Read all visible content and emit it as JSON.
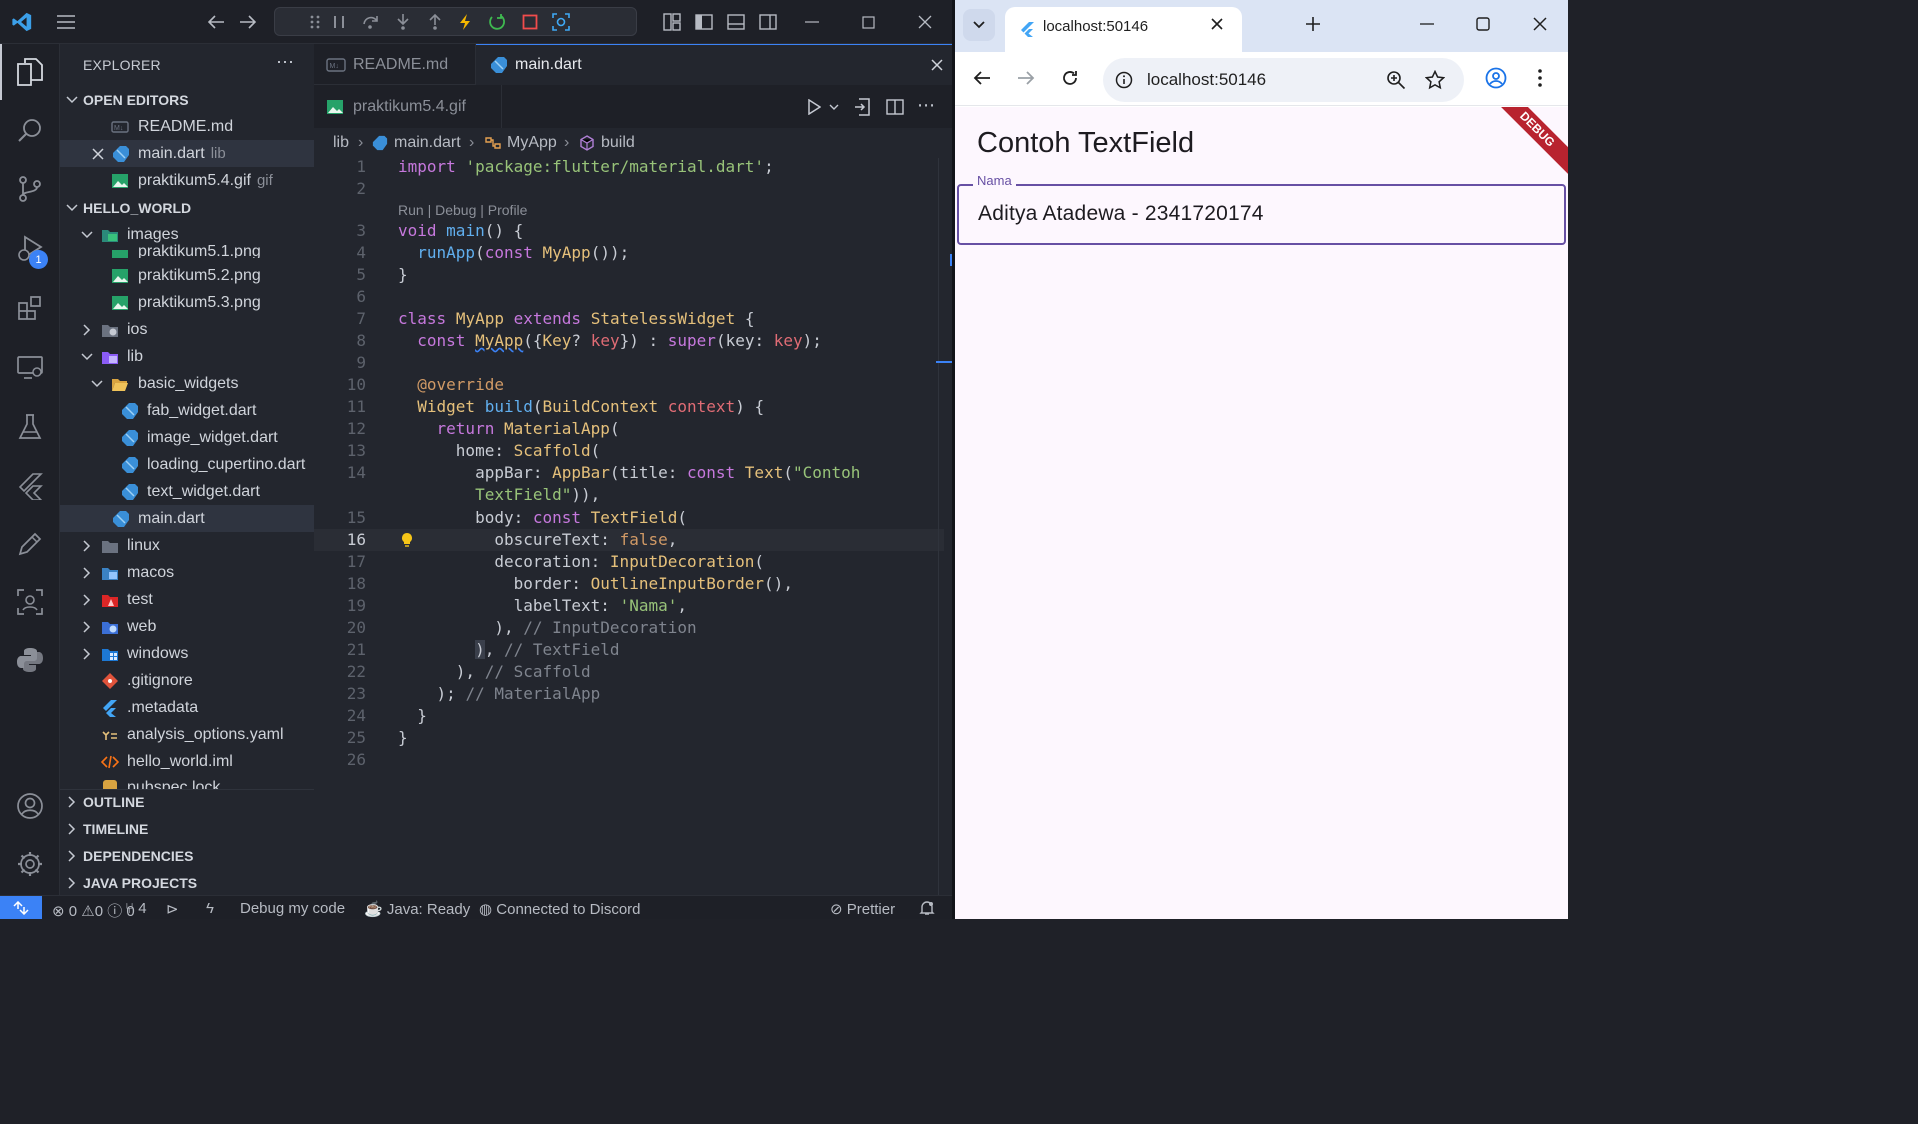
{
  "vscode": {
    "explorer_title": "EXPLORER",
    "debug_badge": "1",
    "sections": {
      "open_editors": "OPEN EDITORS",
      "workspace": "HELLO_WORLD",
      "outline": "OUTLINE",
      "timeline": "TIMELINE",
      "dependencies": "DEPENDENCIES",
      "java_projects": "JAVA PROJECTS"
    },
    "open_editors": [
      {
        "name": "README.md",
        "sub": ""
      },
      {
        "name": "main.dart",
        "sub": "lib"
      },
      {
        "name": "praktikum5.4.gif",
        "sub": "gif"
      }
    ],
    "tree": {
      "images": "images",
      "img_partial": "praktikum5.1.png",
      "img2": "praktikum5.2.png",
      "img3": "praktikum5.3.png",
      "ios": "ios",
      "lib": "lib",
      "basic_widgets": "basic_widgets",
      "fab": "fab_widget.dart",
      "image": "image_widget.dart",
      "loading": "loading_cupertino.dart",
      "text": "text_widget.dart",
      "main": "main.dart",
      "linux": "linux",
      "macos": "macos",
      "test": "test",
      "web": "web",
      "windows": "windows",
      "gitignore": ".gitignore",
      "metadata": ".metadata",
      "analysis": "analysis_options.yaml",
      "iml": "hello_world.iml",
      "lock_partial": "pubspec.lock"
    },
    "tabs": {
      "readme": "README.md",
      "main": "main.dart",
      "gif": "praktikum5.4.gif"
    },
    "breadcrumb": {
      "lib": "lib",
      "file": "main.dart",
      "cls": "MyApp",
      "method": "build"
    },
    "code_lens": "Run | Debug | Profile",
    "status": {
      "errors": "0",
      "warnings": "0",
      "info": "0",
      "ports": "4",
      "debug": "Debug my code",
      "java": "Java: Ready",
      "discord": "Connected to Discord",
      "prettier": "Prettier"
    }
  },
  "browser": {
    "tab_title": "localhost:50146",
    "url": "localhost:50146",
    "app_title": "Contoh TextField",
    "field_label": "Nama",
    "field_value": "Aditya Atadewa - 2341720174",
    "debug_banner": "DEBUG"
  }
}
